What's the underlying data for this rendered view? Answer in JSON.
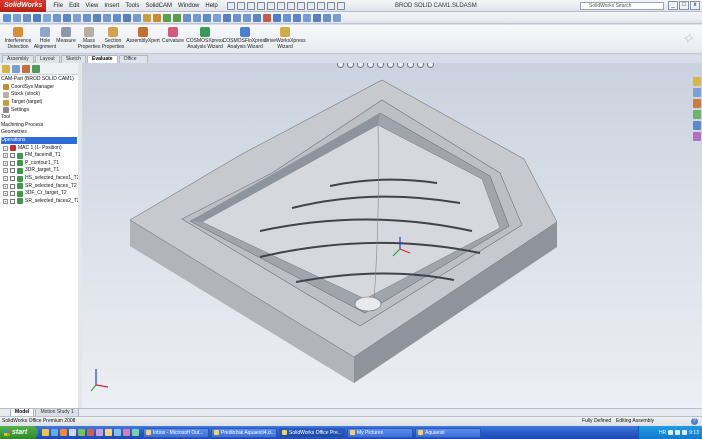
{
  "app": {
    "logo": "SolidWorks",
    "menus": [
      "File",
      "Edit",
      "View",
      "Insert",
      "Tools",
      "SolidCAM",
      "Window",
      "Help"
    ],
    "document_title": "BROD SOLID CAM1.SLDASM",
    "search_placeholder": "SolidWorks Search",
    "window_controls": [
      "_",
      "□",
      "x"
    ]
  },
  "ribbon": {
    "buttons": [
      "Interference Detection",
      "Hole Alignment",
      "Measure",
      "Mass Properties",
      "Section Properties",
      "AssemblyXpert",
      "Curvature",
      "COSMOSXpress Analysis Wizard",
      "COSMOSFloXpress Analysis Wizard",
      "DriveWorksXpress Wizard"
    ]
  },
  "command_tabs": [
    "Assembly",
    "Layout",
    "Sketch",
    "Evaluate",
    "Office Products"
  ],
  "command_tabs_active": "Evaluate",
  "tree": {
    "items": [
      "CAM-Part (BROD SOLID CAM1)",
      "CoordSys Manager",
      "Stock (stock)",
      "Target (target)",
      "Settings",
      "Tool",
      "Machining Process",
      "Geometries",
      "Operations",
      "MAC 1 (1- Position)",
      "FM_facemill_T1",
      "P_contour1_T1",
      "3DR_target_T1",
      "HS_selected_faces1_T2",
      "SR_selected_faces_T2",
      "3DF_Cr_target_T2",
      "SR_selected_faces2_T2"
    ]
  },
  "model_tabs": [
    "Model",
    "Motion Study 1"
  ],
  "status": {
    "left": "SolidWorks Office Premium 2008",
    "fully_defined": "Fully Defined",
    "editing": "Editing Assembly",
    "help": "?"
  },
  "taskbar": {
    "start": "start",
    "tasks": [
      "Inbox - Microsoft Out...",
      "Predložak Aquaesti4.d...",
      "SolidWorks Office Pre...",
      "My Pictures",
      "Aquaesti"
    ],
    "active_task": "SolidWorks Office Pre...",
    "language": "HR",
    "clock": "9:13"
  },
  "colors": {
    "accent": "#2f6bd6",
    "taskbar": "#2457c4",
    "logo_red": "#c8261c"
  }
}
